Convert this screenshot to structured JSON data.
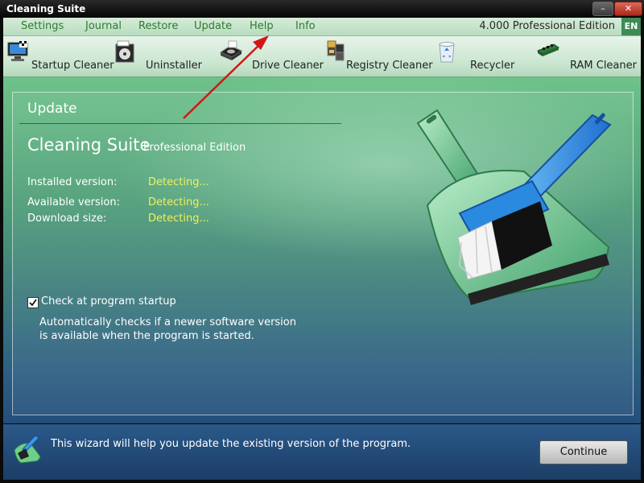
{
  "window": {
    "title": "Cleaning Suite",
    "min_glyph": "–",
    "close_glyph": "✕"
  },
  "menu": {
    "items": [
      "Settings",
      "Journal",
      "Restore",
      "Update",
      "Help",
      "Info"
    ],
    "edition": "4.000 Professional Edition",
    "language": "EN"
  },
  "tools": [
    {
      "label": "Startup Cleaner",
      "icon": "startup-cleaner-icon"
    },
    {
      "label": "Uninstaller",
      "icon": "uninstaller-icon"
    },
    {
      "label": "Drive Cleaner",
      "icon": "drive-cleaner-icon"
    },
    {
      "label": "Registry Cleaner",
      "icon": "registry-cleaner-icon"
    },
    {
      "label": "Recycler",
      "icon": "recycler-icon"
    },
    {
      "label": "RAM Cleaner",
      "icon": "ram-cleaner-icon"
    }
  ],
  "update": {
    "heading": "Update",
    "product_name": "Cleaning Suite",
    "product_edition": "Professional Edition",
    "installed_label": "Installed version:",
    "installed_value": "Detecting...",
    "available_label": "Available version:",
    "available_value": "Detecting...",
    "size_label": "Download size:",
    "size_value": "Detecting...",
    "startup_check_label": "Check at program startup",
    "startup_check_checked": true,
    "startup_check_desc": "Automatically checks if a newer software version is available when the program is started."
  },
  "footer": {
    "wizard_text": "This wizard will help you update the existing version of the program.",
    "continue_label": "Continue"
  },
  "colors": {
    "menu_text": "#2f7a2f",
    "detect_value": "#f4f05a",
    "arrow": "#d01818"
  }
}
